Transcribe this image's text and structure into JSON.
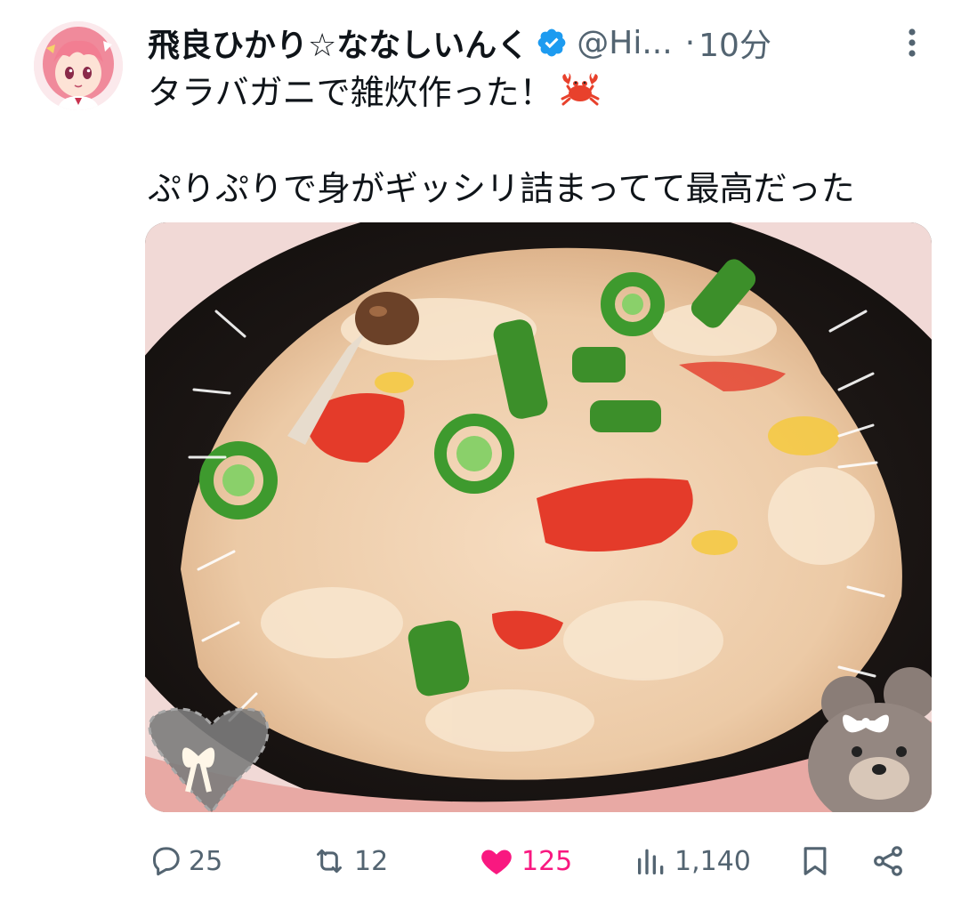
{
  "user": {
    "display_name": "飛良ひかり☆ななしいんく",
    "handle": "@Hi...",
    "separator": "·",
    "time": "10分",
    "verified": true
  },
  "tweet": {
    "line1": "タラバガニで雑炊作った！",
    "line2": "ぷりぷりで身がギッシリ詰まってて最高だった",
    "emoji": "crab"
  },
  "media": {
    "description": "",
    "decorations": [
      "heart-ribbon",
      "bear-sticker"
    ]
  },
  "metrics": {
    "replies": "25",
    "retweets": "12",
    "likes": "125",
    "views": "1,140"
  },
  "colors": {
    "text": "#0f1419",
    "secondary": "#536471",
    "like": "#f91880",
    "verified": "#1d9bf0"
  },
  "icons": {
    "more": "more-vertical-icon",
    "reply": "reply-icon",
    "retweet": "retweet-icon",
    "like": "heart-filled-icon",
    "views": "views-icon",
    "bookmark": "bookmark-icon",
    "share": "share-icon"
  }
}
